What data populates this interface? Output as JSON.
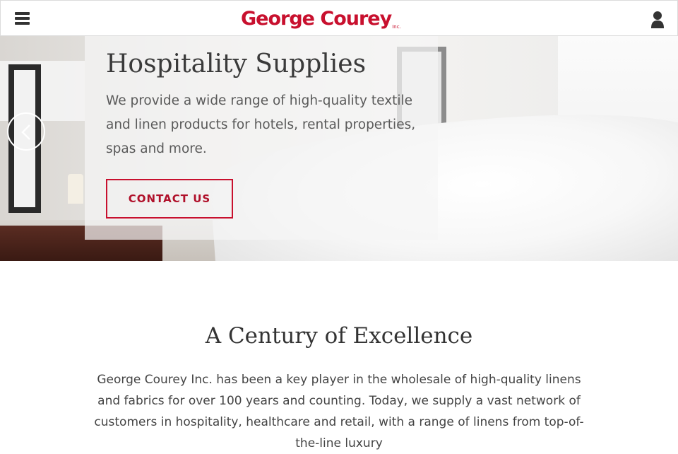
{
  "header": {
    "logo_text": "George Courey",
    "logo_suffix": "Inc.",
    "menu_icon": "hamburger-menu-icon",
    "user_icon": "user-account-icon",
    "brand_color": "#c8102e"
  },
  "hero": {
    "title": "Hospitality Supplies",
    "description": "We provide a wide range of high-quality textile and linen products for hotels, rental properties, spas and more.",
    "cta_label": "CONTACT US",
    "prev_icon": "chevron-left-icon"
  },
  "intro": {
    "title": "A Century of Excellence",
    "body": "George Courey Inc. has been a key player in the wholesale of high-quality linens and fabrics for over 100 years and counting. Today, we supply a vast network of customers in hospitality, healthcare and retail, with a range of linens from top-of-the-line luxury"
  }
}
